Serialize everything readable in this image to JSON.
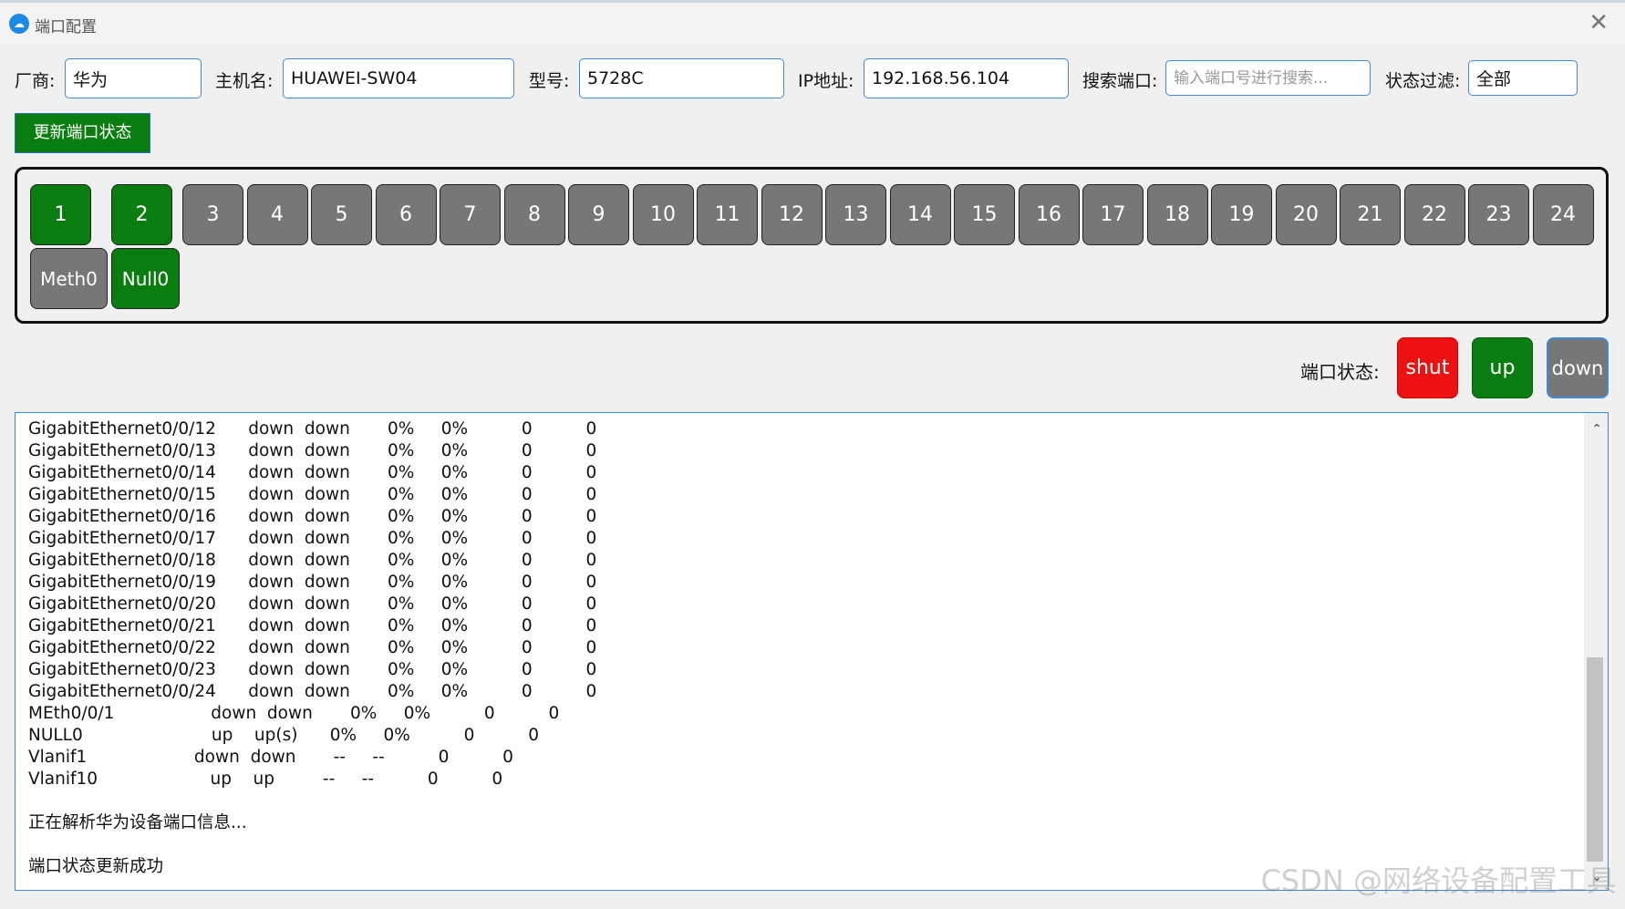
{
  "window": {
    "title": "端口配置",
    "close_glyph": "✕",
    "icon": "cloud-icon"
  },
  "form": {
    "vendor_label": "厂商:",
    "vendor_value": "华为",
    "hostname_label": "主机名:",
    "hostname_value": "HUAWEI-SW04",
    "model_label": "型号:",
    "model_value": "5728C",
    "ip_label": "IP地址:",
    "ip_value": "192.168.56.104",
    "search_label": "搜索端口:",
    "search_placeholder": "输入端口号进行搜索...",
    "filter_label": "状态过滤:",
    "filter_value": "全部"
  },
  "update_button": "更新端口状态",
  "ports": [
    {
      "label": "1",
      "status": "up"
    },
    {
      "label": "2",
      "status": "up"
    },
    {
      "label": "3",
      "status": "down"
    },
    {
      "label": "4",
      "status": "down"
    },
    {
      "label": "5",
      "status": "down"
    },
    {
      "label": "6",
      "status": "down"
    },
    {
      "label": "7",
      "status": "down"
    },
    {
      "label": "8",
      "status": "down"
    },
    {
      "label": "9",
      "status": "down"
    },
    {
      "label": "10",
      "status": "down"
    },
    {
      "label": "11",
      "status": "down"
    },
    {
      "label": "12",
      "status": "down"
    },
    {
      "label": "13",
      "status": "down"
    },
    {
      "label": "14",
      "status": "down"
    },
    {
      "label": "15",
      "status": "down"
    },
    {
      "label": "16",
      "status": "down"
    },
    {
      "label": "17",
      "status": "down"
    },
    {
      "label": "18",
      "status": "down"
    },
    {
      "label": "19",
      "status": "down"
    },
    {
      "label": "20",
      "status": "down"
    },
    {
      "label": "21",
      "status": "down"
    },
    {
      "label": "22",
      "status": "down"
    },
    {
      "label": "23",
      "status": "down"
    },
    {
      "label": "24",
      "status": "down"
    }
  ],
  "extra_ports": [
    {
      "label": "Meth0",
      "status": "down"
    },
    {
      "label": "Null0",
      "status": "up"
    }
  ],
  "status_legend": {
    "label": "端口状态:",
    "items": [
      {
        "label": "shut",
        "color": "#ee1111"
      },
      {
        "label": "up",
        "color": "#0a7d10"
      },
      {
        "label": "down",
        "color": "#777777"
      }
    ]
  },
  "log_lines": [
    "GigabitEthernet0/0/12      down  down       0%     0%          0          0",
    "GigabitEthernet0/0/13      down  down       0%     0%          0          0",
    "GigabitEthernet0/0/14      down  down       0%     0%          0          0",
    "GigabitEthernet0/0/15      down  down       0%     0%          0          0",
    "GigabitEthernet0/0/16      down  down       0%     0%          0          0",
    "GigabitEthernet0/0/17      down  down       0%     0%          0          0",
    "GigabitEthernet0/0/18      down  down       0%     0%          0          0",
    "GigabitEthernet0/0/19      down  down       0%     0%          0          0",
    "GigabitEthernet0/0/20      down  down       0%     0%          0          0",
    "GigabitEthernet0/0/21      down  down       0%     0%          0          0",
    "GigabitEthernet0/0/22      down  down       0%     0%          0          0",
    "GigabitEthernet0/0/23      down  down       0%     0%          0          0",
    "GigabitEthernet0/0/24      down  down       0%     0%          0          0",
    "MEth0/0/1                  down  down       0%     0%          0          0",
    "NULL0                        up    up(s)      0%     0%          0          0",
    "Vlanif1                    down  down       --     --          0          0",
    "Vlanif10                     up    up         --     --          0          0",
    "",
    "正在解析华为设备端口信息...",
    "",
    "端口状态更新成功"
  ],
  "watermark": "CSDN @网络设备配置工具"
}
